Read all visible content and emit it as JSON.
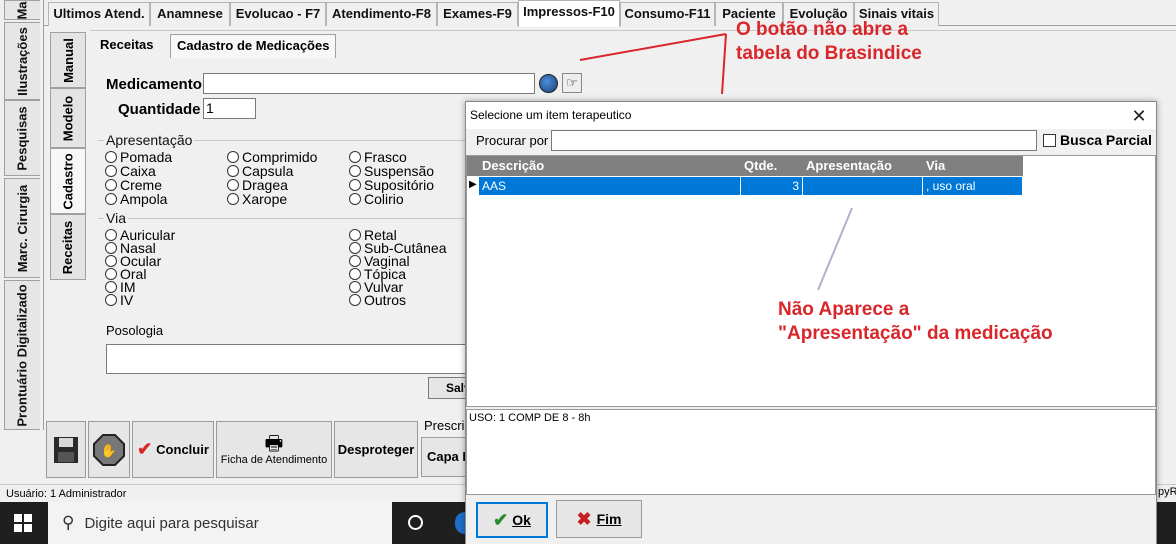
{
  "left_tabs": [
    "Ma",
    "Ilustrações",
    "Pesquisas",
    "Marc. Cirurgia",
    "Prontuário Digitalizado"
  ],
  "top_tabs": [
    "Ultimos Atend.",
    "Anamnese",
    "Evolucao - F7",
    "Atendimento-F8",
    "Exames-F9",
    "Impressos-F10",
    "Consumo-F11",
    "Paciente",
    "Evolução",
    "Sinais vitais"
  ],
  "inner_tabs": [
    "Manual",
    "Modelo",
    "Cadastro",
    "Receitas"
  ],
  "sub_tabs": [
    "Receitas",
    "Cadastro de Medicações"
  ],
  "form": {
    "medicamento_label": "Medicamento",
    "medicamento_value": "",
    "quantidade_label": "Quantidade",
    "quantidade_value": "1",
    "apresentacao_title": "Apresentação",
    "apresentacao": [
      "Pomada",
      "Caixa",
      "Creme",
      "Ampola",
      "Comprimido",
      "Capsula",
      "Dragea",
      "Xarope",
      "Frasco",
      "Suspensão",
      "Supositório",
      "Colirio"
    ],
    "via_title": "Via",
    "via": [
      "Auricular",
      "Nasal",
      "Ocular",
      "Oral",
      "IM",
      "IV",
      "Retal",
      "Sub-Cutânea",
      "Vaginal",
      "Tópica",
      "Vulvar",
      "Outros"
    ],
    "posologia_label": "Posologia",
    "salvar_partial": "Salv"
  },
  "buttons": {
    "concluir": "Concluir",
    "ficha": "Ficha de Atendimento",
    "desproteger": "Desproteger",
    "prescri": "Prescri",
    "capa": "Capa I"
  },
  "status": {
    "usuario": "Usuário: 1  Administrador",
    "right_partial": "pyR"
  },
  "taskbar": {
    "search_placeholder": "Digite aqui para pesquisar"
  },
  "dialog": {
    "title": "Selecione um item terapeutico",
    "procurar_label": "Procurar por",
    "procurar_value": "",
    "busca_parcial": "Busca Parcial",
    "columns": [
      "Descrição",
      "Qtde.",
      "Apresentação",
      "Via"
    ],
    "rows": [
      {
        "descricao": "AAS",
        "qtde": "3",
        "apresentacao": "",
        "via": ", uso oral"
      }
    ],
    "detail": "USO: 1 COMP DE 8 - 8h",
    "ok": "Ok",
    "fim": "Fim"
  },
  "annotations": {
    "top": "O botão não abre a\ntabela do Brasindice",
    "middle": "Não Aparece a\n\"Apresentação\" da medicação"
  },
  "colors": {
    "annotation": "#d9262b",
    "selection": "#0078d7",
    "grid_header": "#808080"
  }
}
